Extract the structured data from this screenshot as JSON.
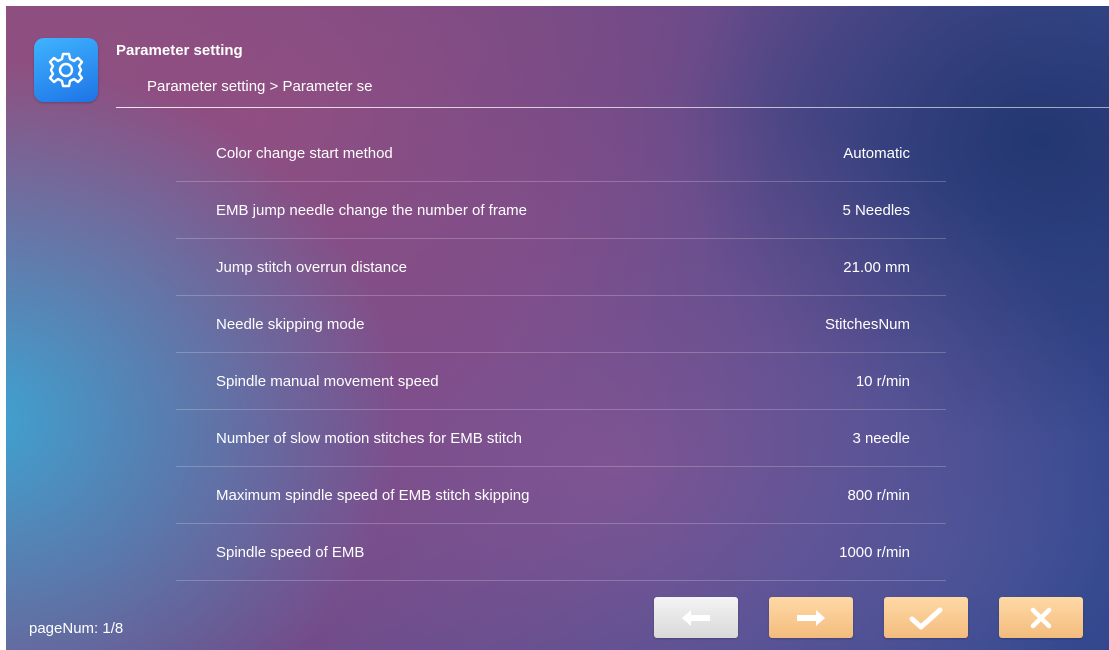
{
  "header": {
    "title": "Parameter setting",
    "breadcrumb": "Parameter setting > Parameter se",
    "icon": "gear-icon"
  },
  "params": [
    {
      "label": "Color change start method",
      "value": "Automatic"
    },
    {
      "label": "EMB jump needle change the number of frame",
      "value": "5 Needles"
    },
    {
      "label": "Jump stitch overrun distance",
      "value": "21.00 mm"
    },
    {
      "label": "Needle skipping mode",
      "value": "StitchesNum"
    },
    {
      "label": "Spindle manual movement speed",
      "value": "10 r/min"
    },
    {
      "label": "Number of slow motion stitches for EMB stitch",
      "value": "3 needle"
    },
    {
      "label": "Maximum spindle speed of EMB stitch skipping",
      "value": "800 r/min"
    },
    {
      "label": "Spindle speed of EMB",
      "value": "1000 r/min"
    }
  ],
  "footer": {
    "page_num": "pageNum: 1/8"
  },
  "buttons": {
    "prev_icon": "arrow-left-icon",
    "next_icon": "arrow-right-icon",
    "ok_icon": "check-icon",
    "cancel_icon": "close-icon"
  },
  "colors": {
    "accent_button": "#f3bc7e",
    "disabled_button": "#d9d9d9",
    "app_icon": "#1e73e6"
  }
}
